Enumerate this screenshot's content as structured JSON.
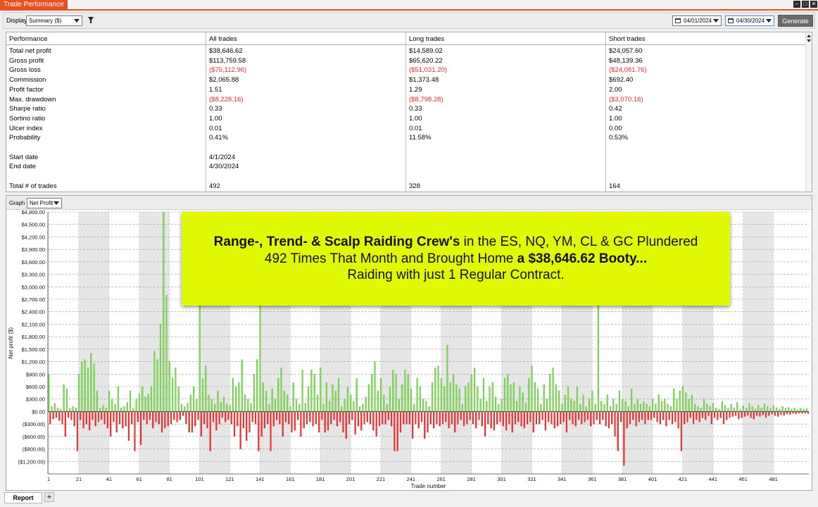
{
  "window": {
    "title": "Trade Performance"
  },
  "toolbar": {
    "display_label": "Display",
    "display_value": "Summary ($)",
    "date_from": "04/01/2024",
    "date_to": "04/30/2024",
    "generate_label": "Generate"
  },
  "table": {
    "headers": [
      "Performance",
      "All trades",
      "Long trades",
      "Short trades"
    ],
    "rows": [
      {
        "label": "Total net profit",
        "all": "$38,646.62",
        "long": "$14,589.02",
        "short": "$24,057.60",
        "neg": false
      },
      {
        "label": "Gross profit",
        "all": "$113,759.58",
        "long": "$65,620.22",
        "short": "$48,139.36",
        "neg": false
      },
      {
        "label": "Gross loss",
        "all": "($75,112.96)",
        "long": "($51,031.20)",
        "short": "($24,081.76)",
        "neg": true
      },
      {
        "label": "Commission",
        "all": "$2,065.88",
        "long": "$1,373.48",
        "short": "$692.40",
        "neg": false
      },
      {
        "label": "Profit factor",
        "all": "1.51",
        "long": "1.29",
        "short": "2.00",
        "neg": false
      },
      {
        "label": "Max. drawdown",
        "all": "($8,228.16)",
        "long": "($8,798.28)",
        "short": "($3,070.16)",
        "neg": true
      },
      {
        "label": "Sharpe ratio",
        "all": "0.33",
        "long": "0.33",
        "short": "0.42",
        "neg": false
      },
      {
        "label": "Sortino ratio",
        "all": "1.00",
        "long": "1.00",
        "short": "1.00",
        "neg": false
      },
      {
        "label": "Ulcer index",
        "all": "0.01",
        "long": "0.01",
        "short": "0.00",
        "neg": false
      },
      {
        "label": "Probability",
        "all": "0.41%",
        "long": "11.58%",
        "short": "0.53%",
        "neg": false
      },
      {
        "label": "",
        "all": "",
        "long": "",
        "short": "",
        "neg": false
      },
      {
        "label": "Start date",
        "all": "4/1/2024",
        "long": "",
        "short": "",
        "neg": false
      },
      {
        "label": "End date",
        "all": "4/30/2024",
        "long": "",
        "short": "",
        "neg": false
      },
      {
        "label": "",
        "all": "",
        "long": "",
        "short": "",
        "neg": false
      },
      {
        "label": "Total # of trades",
        "all": "492",
        "long": "328",
        "short": "164",
        "neg": false
      }
    ]
  },
  "graph": {
    "label": "Graph",
    "select_value": "Net Profit"
  },
  "callout": {
    "bold1": "Range-, Trend- & Scalp Raiding Crew's",
    "text1": " in the ES, NQ, YM, CL & GC Plundered",
    "text2": "492 Times That Month and Brought Home ",
    "bold2": "a $38,646.62 Booty...",
    "text3": "Raiding with just 1 Regular Contract."
  },
  "tabs": {
    "report": "Report",
    "add": "+"
  },
  "colors": {
    "accent": "#e8511f",
    "positive": "#7ed957",
    "negative": "#f23030",
    "callout": "#e2f905"
  },
  "chart_data": {
    "type": "bar",
    "xlabel": "Trade number",
    "ylabel": "Net profit ($)",
    "ylim": [
      -1500,
      4800
    ],
    "xlim": [
      1,
      492
    ],
    "y_ticks": [
      -1200,
      -900,
      -600,
      -300,
      0,
      300,
      600,
      900,
      1200,
      1500,
      1800,
      2100,
      2400,
      2700,
      3000,
      3300,
      3600,
      3900,
      4200,
      4500,
      4800
    ],
    "y_tick_labels": [
      "($1,200.00)",
      "($900.00)",
      "($600.00)",
      "($300.00)",
      "$0.00",
      "$300.00",
      "$600.00",
      "$900.00",
      "$1,200.00",
      "$1,500.00",
      "$1,800.00",
      "$2,100.00",
      "$2,400.00",
      "$2,700.00",
      "$3,000.00",
      "$3,300.00",
      "$3,600.00",
      "$3,900.00",
      "$4,200.00",
      "$4,500.00",
      "$4,800.00"
    ],
    "x_ticks": [
      1,
      21,
      41,
      61,
      81,
      101,
      121,
      141,
      161,
      181,
      201,
      221,
      241,
      261,
      281,
      301,
      321,
      341,
      361,
      381,
      401,
      421,
      441,
      461,
      481
    ],
    "x_tick_labels": [
      "1",
      "21",
      "41",
      "61",
      "81",
      "101",
      "121",
      "141",
      "161",
      "181",
      "201",
      "221",
      "241",
      "261",
      "281",
      "301",
      "321",
      "341",
      "361",
      "381",
      "401",
      "421",
      "441",
      "461",
      "481"
    ],
    "shaded_bands": [
      [
        21,
        41
      ],
      [
        61,
        81
      ],
      [
        101,
        121
      ],
      [
        141,
        161
      ],
      [
        181,
        201
      ],
      [
        221,
        241
      ],
      [
        261,
        281
      ],
      [
        301,
        321
      ],
      [
        341,
        361
      ],
      [
        381,
        401
      ],
      [
        421,
        441
      ],
      [
        461,
        481
      ]
    ],
    "grid": true,
    "values": [
      900,
      -300,
      120,
      -180,
      200,
      -150,
      90,
      -220,
      60,
      -300,
      650,
      -600,
      550,
      -150,
      80,
      -200,
      120,
      -350,
      90,
      -950,
      900,
      -200,
      1200,
      -400,
      1250,
      -300,
      1050,
      -450,
      1400,
      -200,
      1150,
      -350,
      500,
      -250,
      80,
      -200,
      150,
      -300,
      90,
      -400,
      500,
      -600,
      300,
      -250,
      180,
      -500,
      600,
      -300,
      90,
      -400,
      120,
      -350,
      220,
      -700,
      500,
      -300,
      80,
      -950,
      300,
      -250,
      420,
      -800,
      600,
      -200,
      350,
      -300,
      420,
      -200,
      600,
      -400,
      1450,
      -250,
      1250,
      -300,
      2100,
      -500,
      4800,
      -400,
      2800,
      -350,
      1200,
      -300,
      800,
      -200,
      1050,
      -250,
      600,
      -200,
      180,
      -100,
      120,
      -300,
      200,
      -500,
      400,
      -500,
      600,
      -350,
      300,
      -200,
      2600,
      -600,
      800,
      -300,
      1100,
      -400,
      400,
      -950,
      300,
      -250,
      180,
      -450,
      500,
      -300,
      220,
      -150,
      350,
      -250,
      180,
      -200,
      150,
      -300,
      800,
      -600,
      600,
      -350,
      700,
      -900,
      1250,
      -400,
      400,
      -700,
      300,
      -500,
      200,
      -250,
      900,
      -300,
      1250,
      -950,
      2900,
      -600,
      700,
      -400,
      500,
      -300,
      180,
      -950,
      550,
      -350,
      300,
      -200,
      800,
      -300,
      1050,
      -600,
      500,
      -250,
      400,
      -300,
      120,
      -500,
      700,
      -450,
      300,
      -200,
      180,
      -600,
      1000,
      -400,
      200,
      -300,
      600,
      -250,
      1000,
      -350,
      900,
      -300,
      400,
      -500,
      1050,
      -200,
      180,
      -500,
      700,
      -450,
      250,
      -300,
      650,
      -200,
      500,
      -350,
      800,
      -250,
      120,
      -500,
      300,
      -650,
      600,
      -300,
      400,
      -200,
      250,
      -550,
      800,
      -350,
      120,
      -450,
      180,
      -300,
      350,
      -250,
      650,
      -300,
      900,
      -450,
      1200,
      -600,
      500,
      -350,
      800,
      -300,
      400,
      -300,
      180,
      -200,
      600,
      -350,
      1000,
      -950,
      900,
      -950,
      300,
      -500,
      650,
      -300,
      1000,
      -300,
      900,
      -300,
      550,
      -650,
      180,
      -300,
      800,
      -400,
      600,
      -250,
      300,
      -650,
      250,
      -500,
      120,
      -300,
      700,
      -400,
      1050,
      -300,
      1100,
      -350,
      800,
      -300,
      600,
      -250,
      1600,
      -400,
      700,
      -300,
      900,
      -500,
      650,
      -300,
      550,
      -200,
      180,
      -350,
      600,
      -300,
      700,
      -200,
      900,
      -300,
      1050,
      -400,
      600,
      -200,
      300,
      -350,
      800,
      -600,
      250,
      -300,
      600,
      -400,
      700,
      -450,
      350,
      -300,
      180,
      -250,
      300,
      -350,
      800,
      -450,
      900,
      -300,
      650,
      -500,
      700,
      -300,
      250,
      -250,
      600,
      -350,
      450,
      -400,
      200,
      -300,
      800,
      -250,
      1100,
      -500,
      700,
      -300,
      550,
      -300,
      180,
      -200,
      650,
      -450,
      300,
      -250,
      900,
      -300,
      1050,
      -400,
      650,
      -350,
      500,
      -300,
      180,
      -250,
      400,
      -500,
      600,
      -200,
      300,
      -300,
      250,
      -350,
      600,
      -200,
      180,
      -300,
      400,
      -250,
      120,
      -200,
      300,
      -350,
      500,
      -300,
      180,
      -200,
      2700,
      -300,
      250,
      -200,
      180,
      -350,
      400,
      -400,
      120,
      -300,
      300,
      -600,
      180,
      -950,
      500,
      -250,
      300,
      -1300,
      250,
      -400,
      120,
      -300,
      550,
      -200,
      180,
      -350,
      300,
      -250,
      180,
      -200,
      250,
      -300,
      180,
      -200,
      120,
      -200,
      300,
      -150,
      180,
      -250,
      400,
      -300,
      250,
      -200,
      300,
      -350,
      180,
      -200,
      120,
      -300,
      550,
      -250,
      300,
      -400,
      500,
      -950,
      600,
      -300,
      450,
      -250,
      300,
      -150,
      400,
      -300,
      180,
      -200,
      120,
      -250,
      90,
      -150,
      300,
      -200,
      180,
      -100,
      120,
      -300,
      200,
      -150,
      90,
      -200,
      60,
      -150,
      250,
      -300,
      150,
      -200,
      80,
      -150,
      180,
      -120,
      90,
      -100,
      220,
      -180,
      60,
      -150,
      140,
      -120,
      80,
      -90,
      200,
      -150,
      120,
      -180,
      60,
      -100,
      150,
      -120,
      90,
      -80,
      180,
      -150,
      120,
      -100,
      80,
      -60,
      150,
      -100,
      90,
      -120,
      60,
      -80,
      120,
      -90,
      80,
      -60,
      100,
      -70,
      60,
      -50,
      90,
      -60,
      50,
      -40,
      80,
      -50,
      60,
      -40,
      70,
      -50
    ]
  }
}
